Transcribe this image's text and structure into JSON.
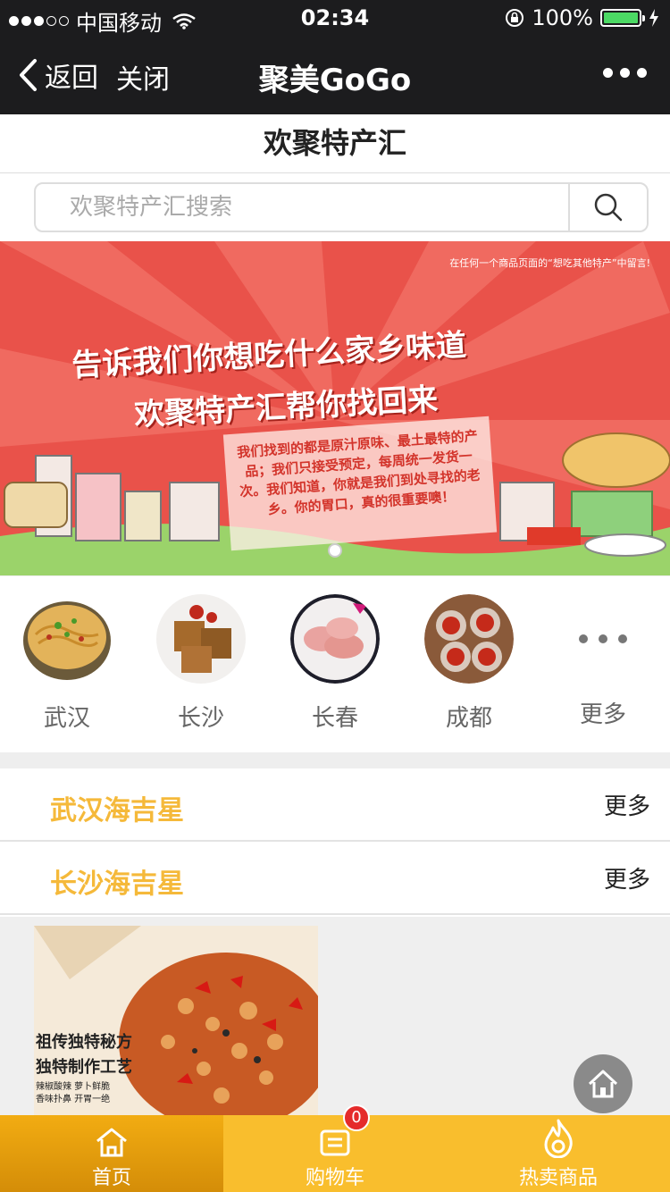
{
  "status_bar": {
    "carrier": "中国移动",
    "time": "02:34",
    "battery_percent": "100%"
  },
  "nav": {
    "back_label": "返回",
    "close_label": "关闭",
    "title": "聚美GoGo"
  },
  "page": {
    "header_title": "欢聚特产汇"
  },
  "search": {
    "placeholder": "欢聚特产汇搜索"
  },
  "banner": {
    "fine_print": "在任何一个商品页面的“想吃其他特产”中留言!",
    "headline_1": "告诉我们你想吃什么家乡味道",
    "headline_2": "欢聚特产汇帮你找回来",
    "note": "我们找到的都是原汁原味、最土最特的产品；我们只接受预定，每周统一发货一次。我们知道，你就是我们到处寻找的老乡。你的胃口，真的很重要噢！"
  },
  "categories": [
    {
      "label": "武汉"
    },
    {
      "label": "长沙"
    },
    {
      "label": "长春"
    },
    {
      "label": "成都"
    },
    {
      "label": "更多"
    }
  ],
  "sections": [
    {
      "title": "武汉海吉星",
      "more": "更多"
    },
    {
      "title": "长沙海吉星",
      "more": "更多"
    }
  ],
  "product": {
    "line1": "祖传独特秘方",
    "line2": "独特制作工艺",
    "line3": "辣椒酸辣 萝卜鲜脆 香味扑鼻 开胃一绝"
  },
  "tabbar": {
    "items": [
      {
        "label": "首页",
        "icon": "home-icon"
      },
      {
        "label": "购物车",
        "icon": "cart-icon"
      },
      {
        "label": "热卖商品",
        "icon": "fire-icon"
      }
    ],
    "cart_badge": "0"
  },
  "colors": {
    "accent_yellow": "#f9be2d",
    "section_title": "#f5b93a",
    "banner_red": "#e9524a"
  }
}
